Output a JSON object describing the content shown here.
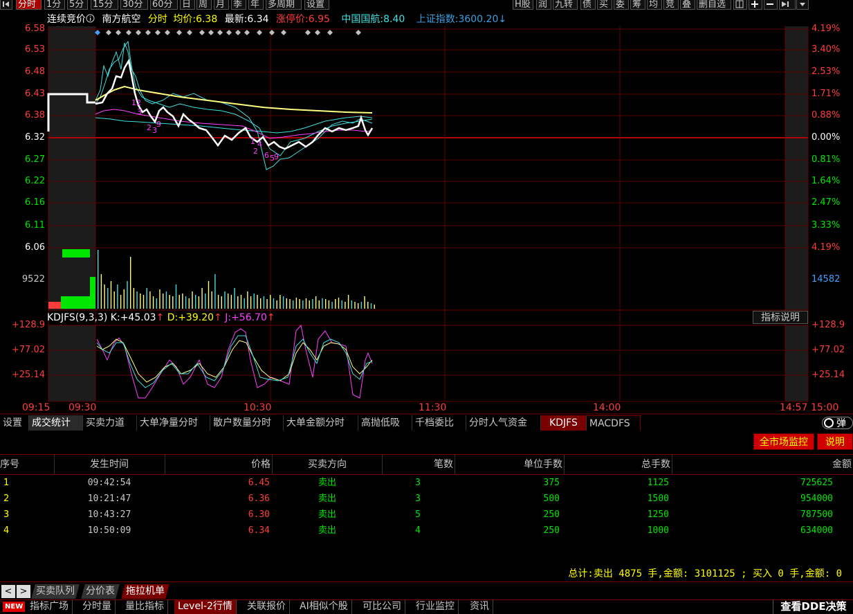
{
  "topbar": {
    "left_icon": "collapse-left-icon",
    "periods": [
      "分时",
      "1分",
      "5分",
      "15分",
      "30分",
      "60分",
      "日",
      "周",
      "月",
      "季",
      "年",
      "多周期",
      "设置"
    ],
    "right_items": [
      "H股",
      "润",
      "九转",
      "债",
      "买",
      "委",
      "筹",
      "均",
      "竞",
      "叠",
      "删自选"
    ],
    "right_icons": [
      "window-icon",
      "plus-icon",
      "minus-icon",
      "collapse-right-icon",
      "dropdown-icon"
    ]
  },
  "infobar": {
    "mode": "连续竞价",
    "mode_icon": "info-circle-icon",
    "stock_name": "南方航空",
    "view": "分时",
    "avg_label": "均价:",
    "avg_value": "6.38",
    "last_label": "最新:",
    "last_value": "6.34",
    "limit_label": "涨停价:",
    "limit_value": "6.95",
    "compare_name": "中国国航:",
    "compare_value": "8.40",
    "index_name": "上证指数:",
    "index_value": "3600.20",
    "index_arrow": "↓"
  },
  "price_axis": {
    "left": [
      "6.58",
      "6.53",
      "6.48",
      "6.43",
      "6.38",
      "6.32",
      "6.27",
      "6.22",
      "6.16",
      "6.11",
      "6.06"
    ],
    "right": [
      "4.19%",
      "3.40%",
      "2.53%",
      "1.71%",
      "0.88%",
      "0.00%",
      "0.81%",
      "1.64%",
      "2.47%",
      "3.33%",
      "4.19%"
    ]
  },
  "volume_axis": {
    "left": "9522",
    "right": "14582"
  },
  "kdj": {
    "title": "KDJFS(9,3,3)",
    "k_label": "K:",
    "k_value": "+45.03",
    "k_arrow": "↑",
    "d_label": "D:",
    "d_value": "+39.20",
    "d_arrow": "↑",
    "j_label": "J:",
    "j_value": "+56.70",
    "j_arrow": "↑",
    "explain": "指标说明",
    "left_axis": [
      "+128.9",
      "+77.02",
      "+25.14"
    ],
    "right_axis": [
      "+128.9",
      "+77.02",
      "+25.14"
    ]
  },
  "time_axis": [
    "09:15",
    "09:30",
    "10:30",
    "11:30",
    "14:00",
    "14:57",
    "15:00"
  ],
  "indicator_tabs": [
    "设置",
    "成交统计",
    "买卖力道",
    "大单净量分时",
    "散户数量分时",
    "大单金额分时",
    "高抛低吸",
    "千档委比",
    "分时人气资金",
    "KDJFS",
    "MACDFS"
  ],
  "toggle_label": "弹",
  "buttons": {
    "market_monitor": "全市场监控",
    "explain": "说明"
  },
  "table": {
    "headers": [
      "序号",
      "发生时间",
      "价格",
      "买卖方向",
      "笔数",
      "单位手数",
      "总手数",
      "金额"
    ],
    "rows": [
      [
        "1",
        "09:42:54",
        "6.45",
        "卖出",
        "3",
        "375",
        "1125",
        "725625"
      ],
      [
        "2",
        "10:21:47",
        "6.36",
        "卖出",
        "3",
        "500",
        "1500",
        "954000"
      ],
      [
        "3",
        "10:43:27",
        "6.30",
        "卖出",
        "5",
        "250",
        "1250",
        "787500"
      ],
      [
        "4",
        "10:50:09",
        "6.34",
        "卖出",
        "4",
        "250",
        "1000",
        "634000"
      ]
    ],
    "summary": "总计:卖出 4875 手,金额: 3101125 ; 买入 0 手,金额: 0"
  },
  "bottom_tabs1": {
    "prev": "<",
    "next": ">",
    "tabs": [
      "买卖队列",
      "分价表",
      "拖拉机单"
    ]
  },
  "bottom_tabs2": {
    "new_badge": "NEW",
    "tabs": [
      "指标广场",
      "分时量",
      "量比指标",
      "Level-2行情",
      "关联报价",
      "AI相似个股",
      "可比公司",
      "行业监控",
      "资讯"
    ],
    "dde": "查看DDE决策"
  },
  "colors": {
    "up": "#ff3c3c",
    "down": "#00e600",
    "grid": "#7a0000",
    "yellow": "#ffff00",
    "cyan": "#40e0e0",
    "magenta": "#ff40ff",
    "white": "#ffffff",
    "avg_line": "#ffff80"
  }
}
